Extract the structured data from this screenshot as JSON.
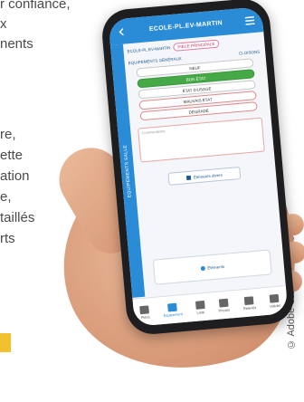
{
  "background_text": {
    "lines": [
      "r confiance,",
      "x",
      "nents",
      "",
      "",
      "re,",
      "ette",
      "ation",
      "e,",
      "taillés",
      "rts"
    ],
    "credit": "© Adobe Stock® / ImmoPad"
  },
  "app": {
    "title": "ECOLE-PL.EV-MARTIN",
    "side_tab": "EQUIPEMENTS SALLE",
    "breadcrumb": {
      "current": "ECOLE-PL.EV-MARTIN",
      "pill": "PIÈCE PRINCIPALE"
    },
    "section": {
      "label": "EQUIPEMENTS GÉNÉRAUX",
      "right_label": "CLOISONS"
    },
    "states": [
      {
        "label": "NEUF",
        "selected": false,
        "tone": "normal"
      },
      {
        "label": "BON ÉTAT",
        "selected": true,
        "tone": "normal"
      },
      {
        "label": "ÉTAT D'USAGE",
        "selected": false,
        "tone": "normal"
      },
      {
        "label": "MAUVAIS ÉTAT",
        "selected": false,
        "tone": "red"
      },
      {
        "label": "DÉGRADÉ",
        "selected": false,
        "tone": "red"
      }
    ],
    "comment_placeholder": "Commentaires",
    "action_button": "Éléments divers",
    "bottom_card": "Éléments",
    "tabs": [
      {
        "label": "Pièce",
        "active": false
      },
      {
        "label": "Équipement",
        "active": true
      },
      {
        "label": "Liste",
        "active": false
      },
      {
        "label": "Photos",
        "active": false
      },
      {
        "label": "Relevés",
        "active": false
      },
      {
        "label": "Valider",
        "active": false
      }
    ],
    "colors": {
      "primary": "#2a8bd7",
      "selected": "#45a945"
    }
  }
}
